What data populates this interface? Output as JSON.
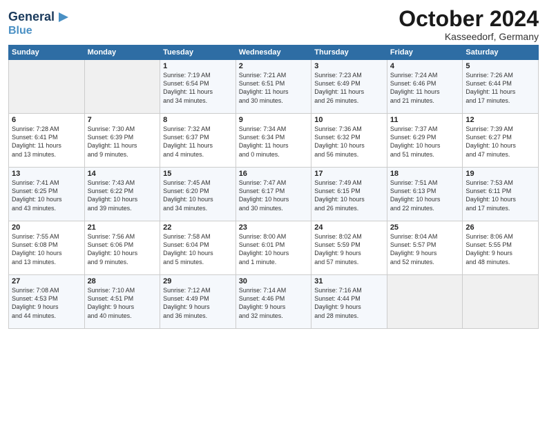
{
  "header": {
    "logo_line1": "General",
    "logo_line2": "Blue",
    "month_title": "October 2024",
    "location": "Kasseedorf, Germany"
  },
  "weekdays": [
    "Sunday",
    "Monday",
    "Tuesday",
    "Wednesday",
    "Thursday",
    "Friday",
    "Saturday"
  ],
  "weeks": [
    [
      {
        "day": "",
        "info": ""
      },
      {
        "day": "",
        "info": ""
      },
      {
        "day": "1",
        "info": "Sunrise: 7:19 AM\nSunset: 6:54 PM\nDaylight: 11 hours\nand 34 minutes."
      },
      {
        "day": "2",
        "info": "Sunrise: 7:21 AM\nSunset: 6:51 PM\nDaylight: 11 hours\nand 30 minutes."
      },
      {
        "day": "3",
        "info": "Sunrise: 7:23 AM\nSunset: 6:49 PM\nDaylight: 11 hours\nand 26 minutes."
      },
      {
        "day": "4",
        "info": "Sunrise: 7:24 AM\nSunset: 6:46 PM\nDaylight: 11 hours\nand 21 minutes."
      },
      {
        "day": "5",
        "info": "Sunrise: 7:26 AM\nSunset: 6:44 PM\nDaylight: 11 hours\nand 17 minutes."
      }
    ],
    [
      {
        "day": "6",
        "info": "Sunrise: 7:28 AM\nSunset: 6:41 PM\nDaylight: 11 hours\nand 13 minutes."
      },
      {
        "day": "7",
        "info": "Sunrise: 7:30 AM\nSunset: 6:39 PM\nDaylight: 11 hours\nand 9 minutes."
      },
      {
        "day": "8",
        "info": "Sunrise: 7:32 AM\nSunset: 6:37 PM\nDaylight: 11 hours\nand 4 minutes."
      },
      {
        "day": "9",
        "info": "Sunrise: 7:34 AM\nSunset: 6:34 PM\nDaylight: 11 hours\nand 0 minutes."
      },
      {
        "day": "10",
        "info": "Sunrise: 7:36 AM\nSunset: 6:32 PM\nDaylight: 10 hours\nand 56 minutes."
      },
      {
        "day": "11",
        "info": "Sunrise: 7:37 AM\nSunset: 6:29 PM\nDaylight: 10 hours\nand 51 minutes."
      },
      {
        "day": "12",
        "info": "Sunrise: 7:39 AM\nSunset: 6:27 PM\nDaylight: 10 hours\nand 47 minutes."
      }
    ],
    [
      {
        "day": "13",
        "info": "Sunrise: 7:41 AM\nSunset: 6:25 PM\nDaylight: 10 hours\nand 43 minutes."
      },
      {
        "day": "14",
        "info": "Sunrise: 7:43 AM\nSunset: 6:22 PM\nDaylight: 10 hours\nand 39 minutes."
      },
      {
        "day": "15",
        "info": "Sunrise: 7:45 AM\nSunset: 6:20 PM\nDaylight: 10 hours\nand 34 minutes."
      },
      {
        "day": "16",
        "info": "Sunrise: 7:47 AM\nSunset: 6:17 PM\nDaylight: 10 hours\nand 30 minutes."
      },
      {
        "day": "17",
        "info": "Sunrise: 7:49 AM\nSunset: 6:15 PM\nDaylight: 10 hours\nand 26 minutes."
      },
      {
        "day": "18",
        "info": "Sunrise: 7:51 AM\nSunset: 6:13 PM\nDaylight: 10 hours\nand 22 minutes."
      },
      {
        "day": "19",
        "info": "Sunrise: 7:53 AM\nSunset: 6:11 PM\nDaylight: 10 hours\nand 17 minutes."
      }
    ],
    [
      {
        "day": "20",
        "info": "Sunrise: 7:55 AM\nSunset: 6:08 PM\nDaylight: 10 hours\nand 13 minutes."
      },
      {
        "day": "21",
        "info": "Sunrise: 7:56 AM\nSunset: 6:06 PM\nDaylight: 10 hours\nand 9 minutes."
      },
      {
        "day": "22",
        "info": "Sunrise: 7:58 AM\nSunset: 6:04 PM\nDaylight: 10 hours\nand 5 minutes."
      },
      {
        "day": "23",
        "info": "Sunrise: 8:00 AM\nSunset: 6:01 PM\nDaylight: 10 hours\nand 1 minute."
      },
      {
        "day": "24",
        "info": "Sunrise: 8:02 AM\nSunset: 5:59 PM\nDaylight: 9 hours\nand 57 minutes."
      },
      {
        "day": "25",
        "info": "Sunrise: 8:04 AM\nSunset: 5:57 PM\nDaylight: 9 hours\nand 52 minutes."
      },
      {
        "day": "26",
        "info": "Sunrise: 8:06 AM\nSunset: 5:55 PM\nDaylight: 9 hours\nand 48 minutes."
      }
    ],
    [
      {
        "day": "27",
        "info": "Sunrise: 7:08 AM\nSunset: 4:53 PM\nDaylight: 9 hours\nand 44 minutes."
      },
      {
        "day": "28",
        "info": "Sunrise: 7:10 AM\nSunset: 4:51 PM\nDaylight: 9 hours\nand 40 minutes."
      },
      {
        "day": "29",
        "info": "Sunrise: 7:12 AM\nSunset: 4:49 PM\nDaylight: 9 hours\nand 36 minutes."
      },
      {
        "day": "30",
        "info": "Sunrise: 7:14 AM\nSunset: 4:46 PM\nDaylight: 9 hours\nand 32 minutes."
      },
      {
        "day": "31",
        "info": "Sunrise: 7:16 AM\nSunset: 4:44 PM\nDaylight: 9 hours\nand 28 minutes."
      },
      {
        "day": "",
        "info": ""
      },
      {
        "day": "",
        "info": ""
      }
    ]
  ]
}
